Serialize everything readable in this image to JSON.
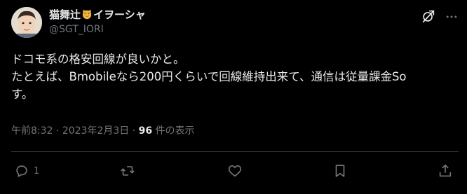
{
  "author": {
    "name_prefix": "猫舞辻",
    "name_suffix": "イヲーシャ",
    "emoji": "grinning-cat-emoji",
    "handle": "@SGT_IORI"
  },
  "tweet": {
    "lines": [
      "ドコモ系の格安回線が良いかと。",
      "たとえば、Bmobileなら200円くらいで回線維持出来て、通信は従量課金So",
      "す。"
    ],
    "time": "午前8:32",
    "sep1": " · ",
    "date": "2023年2月3日",
    "sep2": " · ",
    "view_count": "96",
    "view_label": " 件の表示"
  },
  "actions": {
    "reply_count": "1"
  },
  "colors": {
    "background": "#000000",
    "text": "#e7e9ea",
    "muted": "#71767b",
    "divider": "#2f3336"
  }
}
